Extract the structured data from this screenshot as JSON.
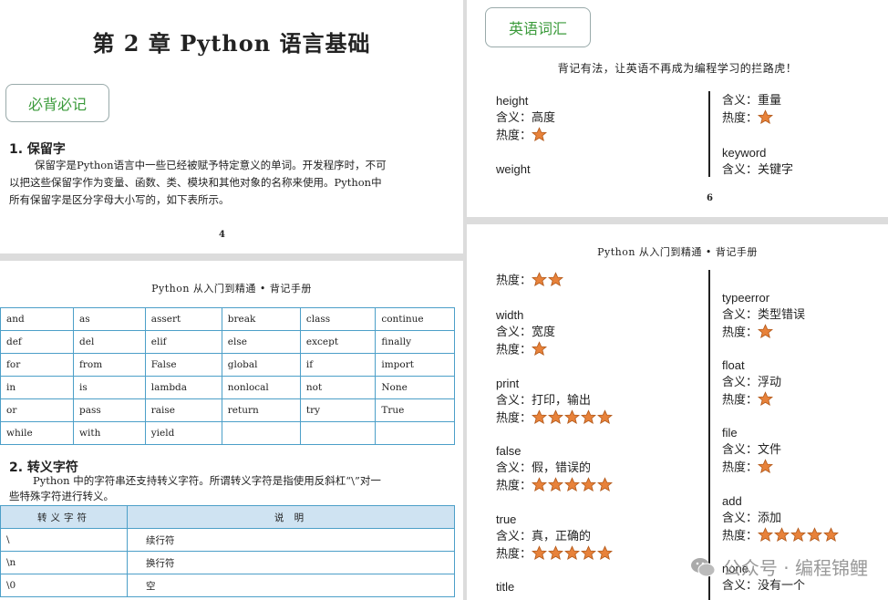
{
  "page1": {
    "chapter_title": "第 2 章  Python 语言基础",
    "box_label": "必背必记",
    "section1_head": "1. 保留字",
    "section1_lines": [
      "保留字是Python语言中一些已经被赋予特定意义的单词。开发程序时，不可",
      "以把这些保留字作为变量、函数、类、模块和其他对象的名称来使用。Python中",
      "所有保留字是区分字母大小写的，如下表所示。"
    ],
    "page_number": "4"
  },
  "page2": {
    "running_head": "Python 从入门到精通 • 背记手册",
    "keywords": [
      [
        "and",
        "as",
        "assert",
        "break",
        "class",
        "continue"
      ],
      [
        "def",
        "del",
        "elif",
        "else",
        "except",
        "finally"
      ],
      [
        "for",
        "from",
        "False",
        "global",
        "if",
        "import"
      ],
      [
        "in",
        "is",
        "lambda",
        "nonlocal",
        "not",
        "None"
      ],
      [
        "or",
        "pass",
        "raise",
        "return",
        "try",
        "True"
      ],
      [
        "while",
        "with",
        "yield",
        "",
        "",
        ""
      ]
    ],
    "section2_head": "2. 转义字符",
    "section2_lines": [
      "Python 中的字符串还支持转义字符。所谓转义字符是指使用反斜杠“\\”对一",
      "些特殊字符进行转义。"
    ],
    "escape_header": [
      "转义字符",
      "说  明"
    ],
    "escape_rows": [
      [
        "\\",
        "续行符"
      ],
      [
        "\\n",
        "换行符"
      ],
      [
        "\\0",
        "空"
      ]
    ]
  },
  "page3": {
    "box_label": "英语词汇",
    "subtitle": "背记有法，让英语不再成为编程学习的拦路虎！",
    "left_entries": [
      {
        "word": "height",
        "meaning_label": "含义：",
        "meaning": "高度",
        "heat_label": "热度：",
        "stars": 1
      },
      {
        "word": "weight"
      }
    ],
    "right_entries": [
      {
        "meaning_label": "含义：",
        "meaning": "重量",
        "heat_label": "热度：",
        "stars": 1
      },
      {
        "word": "keyword",
        "meaning_label": "含义：",
        "meaning": "关键字"
      }
    ],
    "page_number": "6"
  },
  "page4": {
    "running_head": "Python 从入门到精通 • 背记手册",
    "left_entries": [
      {
        "heat_label": "热度：",
        "stars": 2
      },
      {
        "word": "width",
        "meaning_label": "含义：",
        "meaning": "宽度",
        "heat_label": "热度：",
        "stars": 1
      },
      {
        "word": "print",
        "meaning_label": "含义：",
        "meaning": "打印，输出",
        "heat_label": "热度：",
        "stars": 5
      },
      {
        "word": "false",
        "meaning_label": "含义：",
        "meaning": "假，错误的",
        "heat_label": "热度：",
        "stars": 5
      },
      {
        "word": "true",
        "meaning_label": "含义：",
        "meaning": "真，正确的",
        "heat_label": "热度：",
        "stars": 5
      },
      {
        "word": "title"
      }
    ],
    "right_entries": [
      {
        "word": "typeerror",
        "meaning_label": "含义：",
        "meaning": "类型错误",
        "heat_label": "热度：",
        "stars": 1
      },
      {
        "word": "float",
        "meaning_label": "含义：",
        "meaning": "浮动",
        "heat_label": "热度：",
        "stars": 1
      },
      {
        "word": "file",
        "meaning_label": "含义：",
        "meaning": "文件",
        "heat_label": "热度：",
        "stars": 1
      },
      {
        "word": "add",
        "meaning_label": "含义：",
        "meaning": "添加",
        "heat_label": "热度：",
        "stars": 5
      },
      {
        "word": "none",
        "meaning_label": "含义：",
        "meaning": "没有一个"
      }
    ]
  },
  "watermark": {
    "text": "公众号 · 编程锦鲤",
    "icon": "wechat-icon"
  },
  "colors": {
    "star_fill": "#e8823a",
    "star_stroke": "#b35a1c",
    "table_border": "#4c9fc8",
    "table_header_bg": "#cfe3f2",
    "box_text": "#3a9a3a"
  }
}
